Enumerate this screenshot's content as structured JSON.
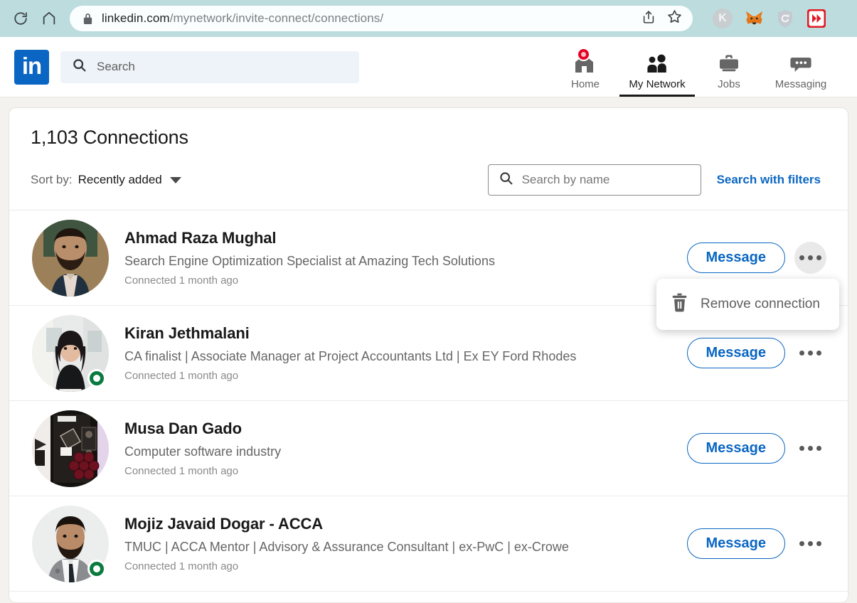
{
  "browser": {
    "reload_icon": "reload-icon",
    "home_icon": "home-icon",
    "lock_icon": "lock-icon",
    "url_domain": "linkedin.com",
    "url_path": "/mynetwork/invite-connect/connections/",
    "share_icon": "share-icon",
    "bookmark_icon": "star-icon",
    "extensions": [
      {
        "name": "keeper-extension-icon",
        "label": "K"
      },
      {
        "name": "metamask-extension-icon",
        "label": ""
      },
      {
        "name": "shield-extension-icon",
        "label": ""
      },
      {
        "name": "fast-forward-extension-icon",
        "label": ""
      }
    ]
  },
  "nav": {
    "logo_text": "in",
    "search_placeholder": "Search",
    "items": [
      {
        "label": "Home",
        "icon": "home-icon",
        "active": false,
        "badge": true
      },
      {
        "label": "My Network",
        "icon": "people-icon",
        "active": true,
        "badge": false
      },
      {
        "label": "Jobs",
        "icon": "briefcase-icon",
        "active": false,
        "badge": false
      },
      {
        "label": "Messaging",
        "icon": "chat-bubble-icon",
        "active": false,
        "badge": false
      }
    ]
  },
  "header": {
    "title": "1,103 Connections",
    "sort_label": "Sort by:",
    "sort_value": "Recently added",
    "search_placeholder": "Search by name",
    "filters_link": "Search with filters"
  },
  "dropdown": {
    "visible": true,
    "icon": "trash-icon",
    "label": "Remove connection"
  },
  "colors": {
    "accent": "#0A66C2",
    "page_background": "#F3F2EF",
    "open_to_work": "#0A7B3E",
    "badge_red": "#e60023",
    "browser_chrome": "#BCDCDE"
  },
  "connections": [
    {
      "name": "Ahmad Raza Mughal",
      "headline": "Search Engine Optimization Specialist at Amazing Tech Solutions",
      "connected": "Connected 1 month ago",
      "message_label": "Message",
      "open_to_work": false,
      "menu_open": true,
      "avatar": "ahmad-avatar"
    },
    {
      "name": "Kiran Jethmalani",
      "headline": "CA finalist | Associate Manager at Project Accountants Ltd | Ex EY Ford Rhodes",
      "connected": "Connected 1 month ago",
      "message_label": "Message",
      "open_to_work": true,
      "menu_open": false,
      "avatar": "kiran-avatar"
    },
    {
      "name": "Musa Dan Gado",
      "headline": "Computer software industry",
      "connected": "Connected 1 month ago",
      "message_label": "Message",
      "open_to_work": false,
      "menu_open": false,
      "avatar": "musa-avatar"
    },
    {
      "name": "Mojiz Javaid Dogar - ACCA",
      "headline": "TMUC | ACCA Mentor | Advisory & Assurance Consultant | ex-PwC | ex-Crowe",
      "connected": "Connected 1 month ago",
      "message_label": "Message",
      "open_to_work": true,
      "menu_open": false,
      "avatar": "mojiz-avatar"
    }
  ]
}
